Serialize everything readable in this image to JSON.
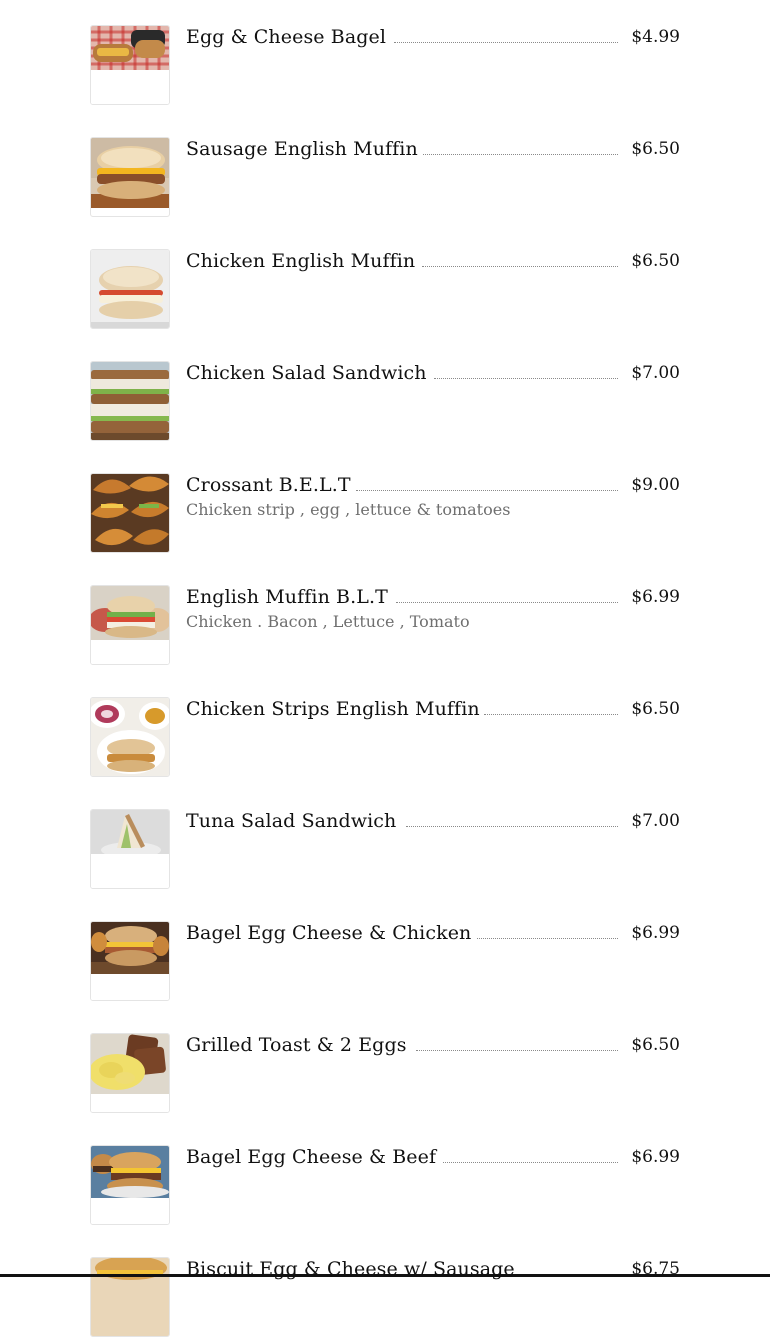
{
  "menu": {
    "items": [
      {
        "name": "Egg & Cheese Bagel",
        "price": "$4.99",
        "description": ""
      },
      {
        "name": "Sausage English Muffin",
        "price": "$6.50",
        "description": ""
      },
      {
        "name": "Chicken English Muffin",
        "price": "$6.50",
        "description": ""
      },
      {
        "name": "Chicken Salad Sandwich",
        "price": "$7.00",
        "description": ""
      },
      {
        "name": "Crossant B.E.L.T",
        "price": "$9.00",
        "description": "Chicken strip , egg , lettuce & tomatoes"
      },
      {
        "name": "English Muffin B.L.T",
        "price": "$6.99",
        "description": "Chicken . Bacon , Lettuce , Tomato"
      },
      {
        "name": "Chicken Strips English Muffin",
        "price": "$6.50",
        "description": ""
      },
      {
        "name": "Tuna Salad Sandwich",
        "price": "$7.00",
        "description": ""
      },
      {
        "name": "Bagel Egg Cheese & Chicken",
        "price": "$6.99",
        "description": ""
      },
      {
        "name": "Grilled Toast & 2 Eggs",
        "price": "$6.50",
        "description": ""
      },
      {
        "name": "Bagel Egg Cheese & Beef",
        "price": "$6.99",
        "description": ""
      },
      {
        "name": "Biscuit Egg & Cheese w/ Sausage",
        "price": "$6.75",
        "description": ""
      }
    ]
  },
  "colors": {
    "text": "#111111",
    "description": "#6f6f6f",
    "leader_dots": "#8a8a8a",
    "thumbnail_border": "#e4e4e4",
    "bottom_bar": "#111111"
  }
}
